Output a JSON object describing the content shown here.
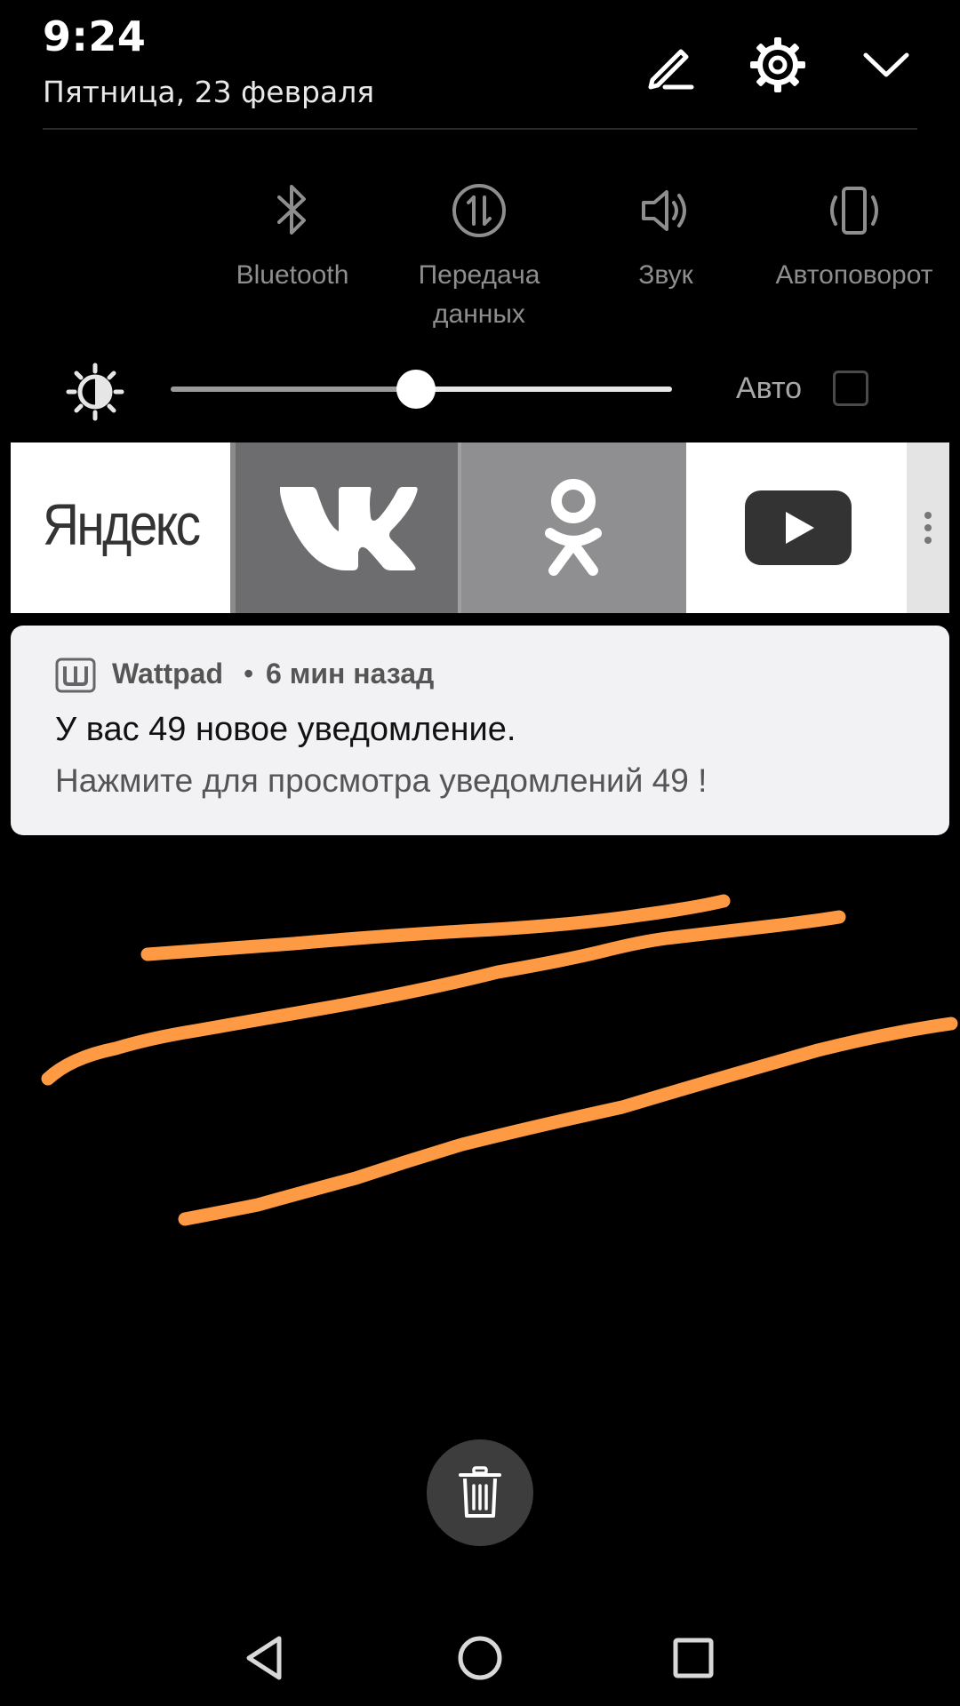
{
  "status": {
    "time": "9:24",
    "date": "Пятница, 23 февраля"
  },
  "header_icons": [
    "edit-icon",
    "settings-icon",
    "collapse-chevron-icon"
  ],
  "toggles": [
    {
      "label": "",
      "icon": "hidden-icon"
    },
    {
      "label": "Bluetooth",
      "icon": "bluetooth-icon"
    },
    {
      "label": "Передача данных",
      "icon": "mobile-data-icon"
    },
    {
      "label": "Звук",
      "icon": "sound-icon"
    },
    {
      "label": "Автоповорот",
      "icon": "auto-rotate-icon"
    }
  ],
  "brightness": {
    "level": 0.49,
    "auto_label": "Авто",
    "auto_checked": false
  },
  "shortcuts": [
    {
      "name": "Яндекс",
      "icon": "yandex-logo"
    },
    {
      "name": "VK",
      "icon": "vk-logo"
    },
    {
      "name": "OK",
      "icon": "odnoklassniki-logo"
    },
    {
      "name": "YouTube",
      "icon": "youtube-logo"
    }
  ],
  "notification": {
    "app": "Wattpad",
    "separator": "•",
    "time": "6 мин назад",
    "title": "У вас 49 новое уведомление.",
    "text": "Нажмите для просмотра уведомлений 49 !",
    "icon": "wattpad-icon"
  },
  "annotation_color": "#ff9a44",
  "colors": {
    "background": "#000000",
    "notification_bg": "#f2f1f3",
    "toggle_label": "#8e8e8e"
  },
  "nav": [
    "back-icon",
    "home-icon",
    "recents-icon"
  ]
}
